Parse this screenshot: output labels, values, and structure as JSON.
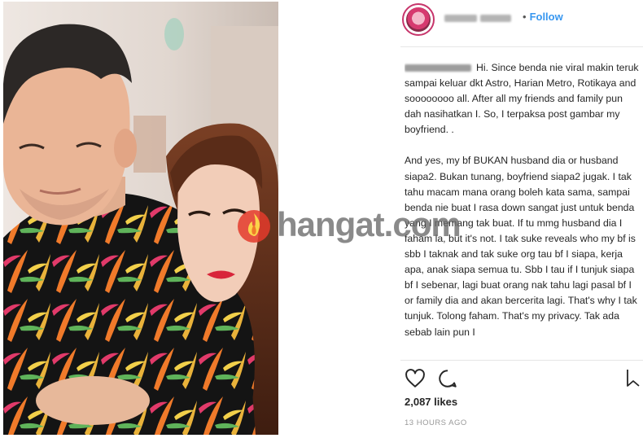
{
  "post": {
    "follow_dot": "•",
    "follow_label": "Follow",
    "caption_p1": "Hi. Since benda nie viral makin teruk sampai keluar dkt Astro, Harian Metro, Rotikaya and soooooooo all. After all my friends and family pun dah nasihatkan I. So, I terpaksa post gambar my boyfriend. .",
    "caption_p2": "And yes, my bf BUKAN husband dia or husband siapa2. Bukan tunang, boyfriend siapa2 jugak. I tak tahu macam mana orang boleh kata sama, sampai benda nie buat I rasa down sangat just untuk benda yang I memang tak buat. If tu mmg husband dia I faham la, but it's not. I tak suke reveals who my bf is sbb I taknak and tak suke org tau bf I siapa, kerja apa, anak siapa semua tu. Sbb I tau if I tunjuk siapa bf I sebenar, lagi buat orang nak tahu lagi pasal bf I or family dia and akan bercerita lagi. That's why I tak tunjuk. Tolong faham. That's my privacy. Tak ada sebab lain pun I",
    "likes": "2,087 likes",
    "time": "13 HOURS AGO"
  },
  "watermark": {
    "text": "hangat.com"
  },
  "icons": {
    "like": "heart-icon",
    "comment": "comment-icon",
    "save": "bookmark-icon",
    "watermark": "flame-icon"
  },
  "colors": {
    "follow": "#3897f0",
    "avatar_ring": "#c7356b",
    "shirt_orange": "#f07a2a",
    "shirt_black": "#141414",
    "lipstick": "#d8253a"
  }
}
